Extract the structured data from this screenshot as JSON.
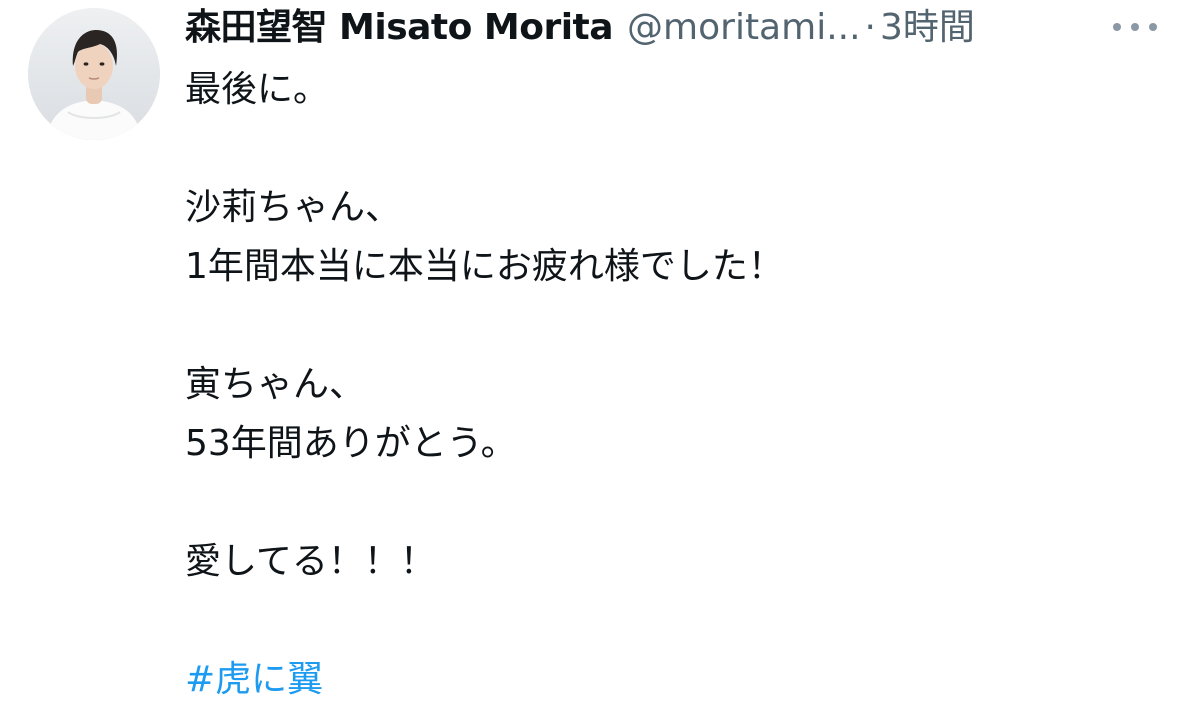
{
  "tweet": {
    "author": {
      "display_name": "森田望智 Misato Morita",
      "handle": "@moritami...",
      "avatar_icon": "profile-photo"
    },
    "separator": "·",
    "timestamp": "3時間",
    "more_icon": "more-horizontal-icon",
    "lines": [
      "最後に。",
      "",
      "沙莉ちゃん、",
      "1年間本当に本当にお疲れ様でした！",
      "",
      "寅ちゃん、",
      "53年間ありがとう。",
      "",
      "愛してる！！！",
      ""
    ],
    "hashtag": "#虎に翼"
  },
  "colors": {
    "text": "#0f1419",
    "secondary": "#536471",
    "link": "#1d9bf0",
    "background": "#ffffff"
  }
}
